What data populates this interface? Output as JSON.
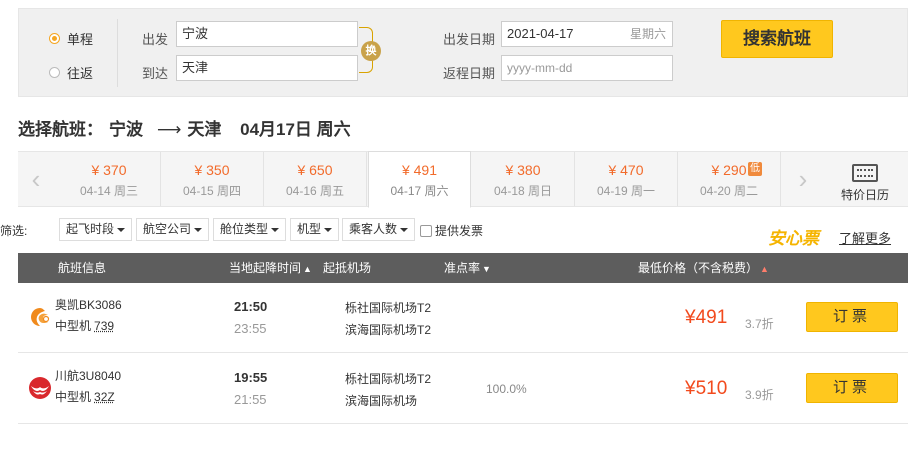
{
  "search": {
    "one_way_label": "单程",
    "round_trip_label": "往返",
    "depart_label": "出发",
    "arrive_label": "到达",
    "depart_city": "宁波",
    "arrive_city": "天津",
    "swap_label": "换",
    "depart_date_label": "出发日期",
    "return_date_label": "返程日期",
    "depart_date": "2021-04-17",
    "depart_weekday": "星期六",
    "return_date_placeholder": "yyyy-mm-dd",
    "search_button": "搜索航班",
    "accent_color": "#ffc81e"
  },
  "route": {
    "prefix": "选择航班：",
    "from": "宁波",
    "arrow": "⟶",
    "to": "天津",
    "date": "04月17日 周六"
  },
  "date_bar": {
    "items": [
      {
        "price": "¥ 370",
        "date": "04-14 周三"
      },
      {
        "price": "¥ 350",
        "date": "04-15 周四"
      },
      {
        "price": "¥ 650",
        "date": "04-16 周五"
      },
      {
        "price": "¥ 491",
        "date": "04-17 周六"
      },
      {
        "price": "¥ 380",
        "date": "04-18 周日"
      },
      {
        "price": "¥ 470",
        "date": "04-19 周一"
      },
      {
        "price": "¥ 290",
        "date": "04-20 周二"
      }
    ],
    "active_index": 3,
    "low_tag": "低",
    "calendar_label": "特价日历"
  },
  "filters": {
    "label": "筛选:",
    "dropdowns": [
      "起飞时段",
      "航空公司",
      "舱位类型",
      "机型",
      "乘客人数"
    ],
    "invoice_label": "提供发票",
    "anxin_label": "安心票",
    "learn_more": "了解更多"
  },
  "table": {
    "headers": {
      "flight_info": "航班信息",
      "times": "当地起降时间",
      "airports": "起抵机场",
      "punctuality": "准点率",
      "price": "最低价格（不含税费）"
    },
    "rows": [
      {
        "flight": "奥凯BK3086",
        "size": "中型机",
        "model": "739",
        "dep_time": "21:50",
        "arr_time": "23:55",
        "dep_airport": "栎社国际机场T2",
        "arr_airport": "滨海国际机场T2",
        "punctuality": "",
        "price": "¥491",
        "discount": "3.7折",
        "book": "订票",
        "logo_color": "#f08a1c"
      },
      {
        "flight": "川航3U8040",
        "size": "中型机",
        "model": "32Z",
        "dep_time": "19:55",
        "arr_time": "21:55",
        "dep_airport": "栎社国际机场T2",
        "arr_airport": "滨海国际机场",
        "punctuality": "100.0%",
        "price": "¥510",
        "discount": "3.9折",
        "book": "订票",
        "logo_color": "#d9282d"
      }
    ]
  }
}
